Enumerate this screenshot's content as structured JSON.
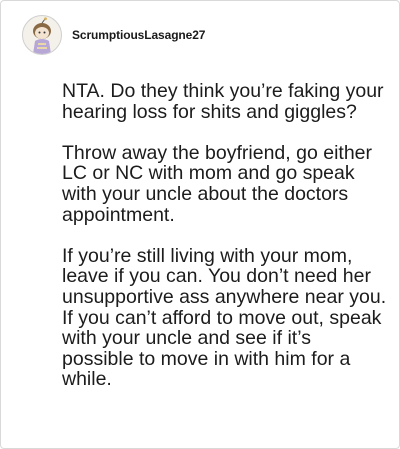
{
  "comment": {
    "username": "ScrumptiousLasagne27",
    "avatar_icon": "snoo-avatar-icon",
    "paragraphs": [
      "NTA. Do they think you’re faking your hearing loss for shits and giggles?",
      "Throw away the boyfriend, go either LC or NC with mom and go speak with your uncle about the doctors appointment.",
      "If you’re still living with your mom, leave if you can. You don’t need her unsupportive ass anywhere near you. If you can’t afford to move out, speak with your uncle and see if it’s possible to move in with him for a while."
    ]
  },
  "colors": {
    "border": "#d9d9d9",
    "text": "#1c1c1c",
    "avatar_bg": "#f4f1ea"
  }
}
